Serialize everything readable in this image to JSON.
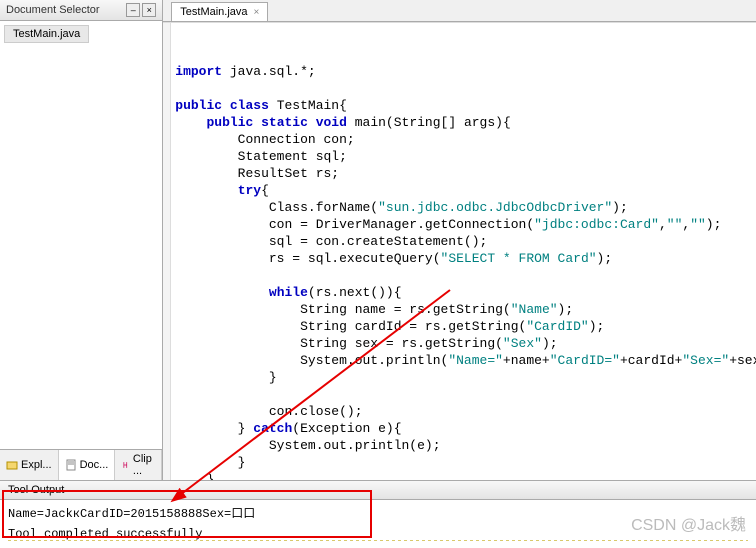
{
  "leftPanel": {
    "title": "Document Selector",
    "minimize": "–",
    "close": "×",
    "docItem": "TestMain.java",
    "tabs": {
      "expl": "Expl...",
      "doc": "Doc...",
      "clip": "Clip ..."
    }
  },
  "editor": {
    "tab": {
      "name": "TestMain.java",
      "close": "×"
    }
  },
  "code": {
    "l1a": "import",
    "l1b": " java.sql.*;",
    "l2a": "public",
    "l2b": " class",
    "l2c": " TestMain{",
    "l3a": "public",
    "l3b": " static",
    "l3c": " void",
    "l3d": " main(String[] args){",
    "l4": "        Connection con;",
    "l5": "        Statement sql;",
    "l6": "        ResultSet rs;",
    "l7a": "try",
    "l7b": "{",
    "l8a": "            Class.forName(",
    "l8s": "\"sun.jdbc.odbc.JdbcOdbcDriver\"",
    "l8b": ");",
    "l9a": "            con = DriverManager.getConnection(",
    "l9s1": "\"jdbc:odbc:Card\"",
    "l9m": ",",
    "l9s2": "\"\"",
    "l9n": ",",
    "l9s3": "\"\"",
    "l9b": ");",
    "l10": "            sql = con.createStatement();",
    "l11a": "            rs = sql.executeQuery(",
    "l11s": "\"SELECT * FROM Card\"",
    "l11b": ");",
    "l12a": "while",
    "l12b": "(rs.next()){",
    "l13a": "                String name = rs.getString(",
    "l13s": "\"Name\"",
    "l13b": ");",
    "l14a": "                String cardId = rs.getString(",
    "l14s": "\"CardID\"",
    "l14b": ");",
    "l15a": "                String sex = rs.getString(",
    "l15s": "\"Sex\"",
    "l15b": ");",
    "l16a": "                System.out.println(",
    "l16s1": "\"Name=\"",
    "l16m1": "+name+",
    "l16s2": "\"CardID=\"",
    "l16m2": "+cardId+",
    "l16s3": "\"Sex=\"",
    "l16m3": "+sex)",
    "l17": "            }",
    "l18": "            con.close();",
    "l19a": "        } ",
    "l19k": "catch",
    "l19b": "(Exception e){",
    "l20": "            System.out.println(e);",
    "l21": "        }",
    "l22": "    }",
    "l23": "}"
  },
  "toolOutput": {
    "title": "Tool Output",
    "line1": "Name=JackкCardID=2015158888Sex=口口",
    "line2": "Tool completed successfully"
  },
  "watermark": "CSDN @Jack魏"
}
